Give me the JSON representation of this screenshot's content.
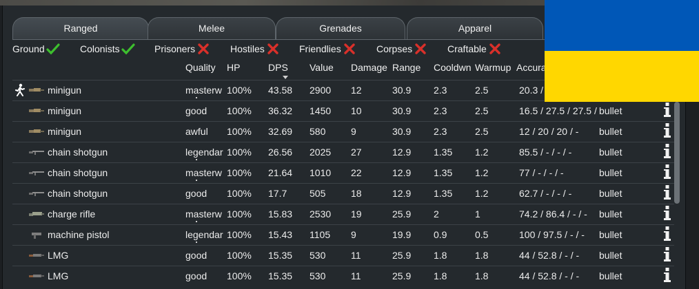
{
  "tabs": [
    {
      "label": "Ranged",
      "active": true
    },
    {
      "label": "Melee",
      "active": false
    },
    {
      "label": "Grenades",
      "active": false
    },
    {
      "label": "Apparel",
      "active": false
    }
  ],
  "filters": [
    {
      "label": "Ground",
      "state": "on"
    },
    {
      "label": "Colonists",
      "state": "on"
    },
    {
      "label": "Prisoners",
      "state": "off"
    },
    {
      "label": "Hostiles",
      "state": "off"
    },
    {
      "label": "Friendlies",
      "state": "off"
    },
    {
      "label": "Corpses",
      "state": "off"
    },
    {
      "label": "Craftable",
      "state": "off"
    }
  ],
  "columns": {
    "quality": "Quality",
    "hp": "HP",
    "dps": "DPS",
    "value": "Value",
    "damage": "Damage",
    "range": "Range",
    "cooldown": "Cooldwn",
    "warmup": "Warmup",
    "accuracy": "Accura"
  },
  "rows": [
    {
      "icon": "minigun-icon",
      "held_by_colonist": true,
      "name": "minigun",
      "quality": "masterw",
      "hp": "100%",
      "dps": "43.58",
      "value": "2900",
      "damage": "12",
      "range": "30.9",
      "cooldown": "2.3",
      "warmup": "2.5",
      "accuracy": "20.3 /",
      "ammo": ""
    },
    {
      "icon": "minigun-icon",
      "held_by_colonist": false,
      "name": "minigun",
      "quality": "good",
      "hp": "100%",
      "dps": "36.32",
      "value": "1450",
      "damage": "10",
      "range": "30.9",
      "cooldown": "2.3",
      "warmup": "2.5",
      "accuracy": "16.5 / 27.5 / 27.5 /",
      "ammo": "bullet"
    },
    {
      "icon": "minigun-icon",
      "held_by_colonist": false,
      "name": "minigun",
      "quality": "awful",
      "hp": "100%",
      "dps": "32.69",
      "value": "580",
      "damage": "9",
      "range": "30.9",
      "cooldown": "2.3",
      "warmup": "2.5",
      "accuracy": "12 / 20 / 20 / -",
      "ammo": "bullet"
    },
    {
      "icon": "chain-shotgun-icon",
      "held_by_colonist": false,
      "name": "chain shotgun",
      "quality": "legendar",
      "hp": "100%",
      "dps": "26.56",
      "value": "2025",
      "damage": "27",
      "range": "12.9",
      "cooldown": "1.35",
      "warmup": "1.2",
      "accuracy": "85.5 / - / - / -",
      "ammo": "bullet"
    },
    {
      "icon": "chain-shotgun-icon",
      "held_by_colonist": false,
      "name": "chain shotgun",
      "quality": "masterw",
      "hp": "100%",
      "dps": "21.64",
      "value": "1010",
      "damage": "22",
      "range": "12.9",
      "cooldown": "1.35",
      "warmup": "1.2",
      "accuracy": "77 / - / - / -",
      "ammo": "bullet"
    },
    {
      "icon": "chain-shotgun-icon",
      "held_by_colonist": false,
      "name": "chain shotgun",
      "quality": "good",
      "hp": "100%",
      "dps": "17.7",
      "value": "505",
      "damage": "18",
      "range": "12.9",
      "cooldown": "1.35",
      "warmup": "1.2",
      "accuracy": "62.7 / - / - / -",
      "ammo": "bullet"
    },
    {
      "icon": "charge-rifle-icon",
      "held_by_colonist": false,
      "name": "charge rifle",
      "quality": "masterw",
      "hp": "100%",
      "dps": "15.83",
      "value": "2530",
      "damage": "19",
      "range": "25.9",
      "cooldown": "2",
      "warmup": "1",
      "accuracy": "74.2 / 86.4 / - / -",
      "ammo": "bullet"
    },
    {
      "icon": "machine-pistol-icon",
      "held_by_colonist": false,
      "name": "machine pistol",
      "quality": "legendar",
      "hp": "100%",
      "dps": "15.43",
      "value": "1105",
      "damage": "9",
      "range": "19.9",
      "cooldown": "0.9",
      "warmup": "0.5",
      "accuracy": "100 / 97.5 / - / -",
      "ammo": "bullet"
    },
    {
      "icon": "lmg-icon",
      "held_by_colonist": false,
      "name": "LMG",
      "quality": "good",
      "hp": "100%",
      "dps": "15.35",
      "value": "530",
      "damage": "11",
      "range": "25.9",
      "cooldown": "1.8",
      "warmup": "1.8",
      "accuracy": "44 / 52.8 / - / -",
      "ammo": "bullet"
    },
    {
      "icon": "lmg-icon",
      "held_by_colonist": false,
      "name": "LMG",
      "quality": "good",
      "hp": "100%",
      "dps": "15.35",
      "value": "530",
      "damage": "11",
      "range": "25.9",
      "cooldown": "1.8",
      "warmup": "1.8",
      "accuracy": "44 / 52.8 / - / -",
      "ammo": "bullet"
    }
  ],
  "colors": {
    "check_on": "#3dbf2e",
    "check_off": "#d9302a",
    "flag_blue": "#0057b7",
    "flag_yellow": "#ffd700"
  }
}
